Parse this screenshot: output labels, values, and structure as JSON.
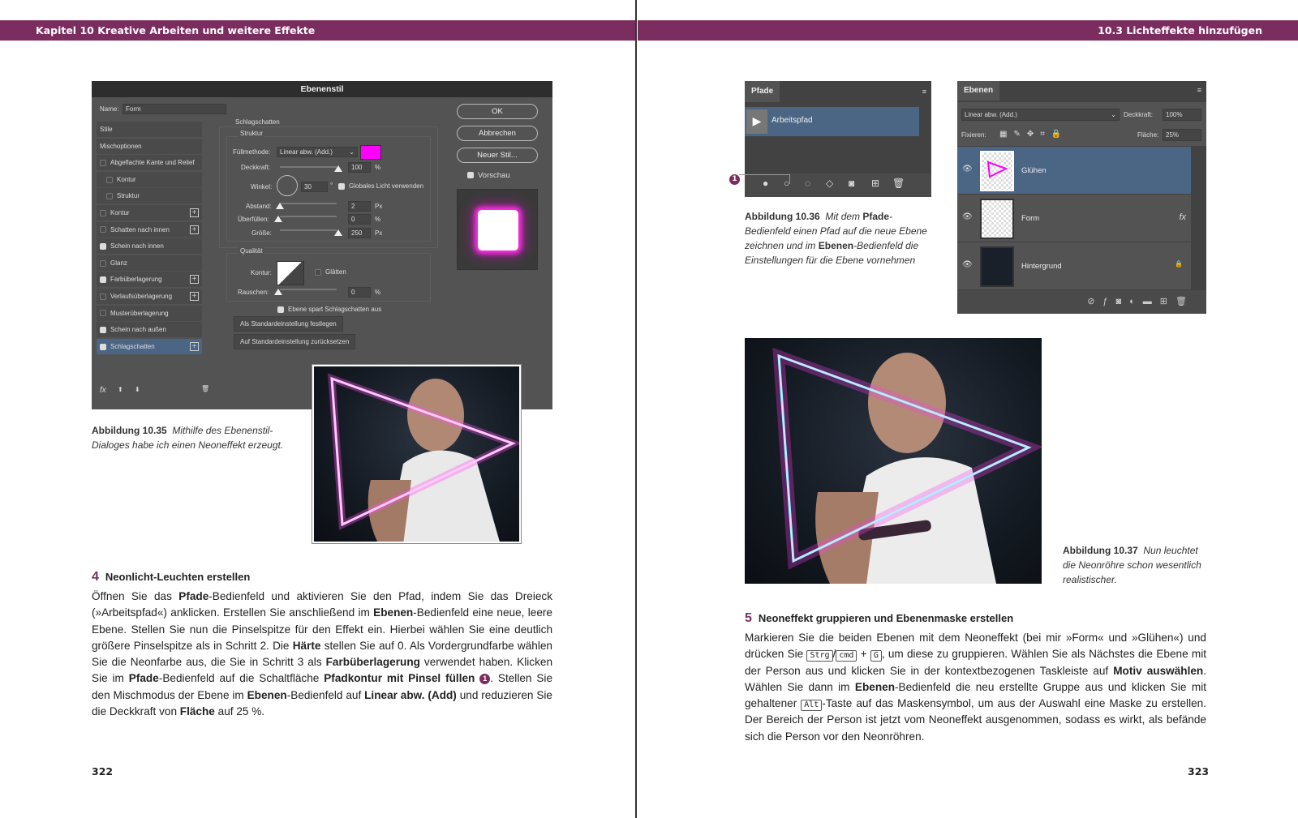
{
  "header": {
    "left": "Kapitel 10  Kreative Arbeiten und weitere Effekte",
    "right": "10.3  Lichteffekte hinzufügen"
  },
  "dialog": {
    "title": "Ebenenstil",
    "name_label": "Name:",
    "name_value": "Form",
    "styles": [
      {
        "label": "Stile",
        "cb": null,
        "plus": false
      },
      {
        "label": "Mischoptionen",
        "cb": null,
        "plus": false
      },
      {
        "label": "Abgeflachte Kante und Relief",
        "cb": false,
        "plus": false
      },
      {
        "label": "Kontur",
        "cb": false,
        "plus": false,
        "indent": true
      },
      {
        "label": "Struktur",
        "cb": false,
        "plus": false,
        "indent": true
      },
      {
        "label": "Kontur",
        "cb": false,
        "plus": true
      },
      {
        "label": "Schatten nach innen",
        "cb": false,
        "plus": true
      },
      {
        "label": "Schein nach innen",
        "cb": true,
        "plus": false
      },
      {
        "label": "Glanz",
        "cb": false,
        "plus": false
      },
      {
        "label": "Farbüberlagerung",
        "cb": true,
        "plus": true
      },
      {
        "label": "Verlaufsüberlagerung",
        "cb": false,
        "plus": true
      },
      {
        "label": "Musterüberlagerung",
        "cb": false,
        "plus": false
      },
      {
        "label": "Schein nach außen",
        "cb": true,
        "plus": false
      },
      {
        "label": "Schlagschatten",
        "cb": true,
        "plus": true,
        "selected": true
      }
    ],
    "section": "Schlagschatten",
    "struktur": "Struktur",
    "fill_label": "Füllmethode:",
    "fill_value": "Linear abw. (Add.)",
    "color": "#ff00ff",
    "opacity_label": "Deckkraft:",
    "opacity_value": "100",
    "opacity_unit": "%",
    "angle_label": "Winkel:",
    "angle_value": "30",
    "angle_unit": "°",
    "global_light": "Globales Licht verwenden",
    "distance_label": "Abstand:",
    "distance_value": "2",
    "distance_unit": "Px",
    "spread_label": "Überfüllen:",
    "spread_value": "0",
    "spread_unit": "%",
    "size_label": "Größe:",
    "size_value": "250",
    "size_unit": "Px",
    "quality": "Qualität",
    "contour_label": "Kontur:",
    "smooth": "Glätten",
    "noise_label": "Rauschen:",
    "noise_value": "0",
    "noise_unit": "%",
    "knockout": "Ebene spart Schlagschatten aus",
    "set_default": "Als Standardeinstellung festlegen",
    "reset_default": "Auf Standardeinstellung zurücksetzen",
    "ok": "OK",
    "cancel": "Abbrechen",
    "new_style": "Neuer Stil...",
    "preview": "Vorschau",
    "fx": "fx"
  },
  "fig35": {
    "label": "Abbildung 10.35",
    "text": "Mithilfe des Ebenenstil-Dialoges habe ich einen Neoneffekt erzeugt."
  },
  "paths": {
    "tab": "Pfade",
    "item": "Arbeitspfad",
    "marker": "1"
  },
  "fig36": {
    "label": "Abbildung 10.36",
    "t1": "Mit dem ",
    "b1": "Pfade",
    "t2": "-Bedienfeld einen Pfad auf die neue Ebene zeichnen und im ",
    "b2": "Ebenen",
    "t3": "-Bedienfeld die Einstellungen für die Ebene vornehmen"
  },
  "layers": {
    "tab": "Ebenen",
    "blend": "Linear abw. (Add.)",
    "opacity_label": "Deckkraft:",
    "opacity": "100%",
    "lock_label": "Fixieren:",
    "fill_label": "Fläche:",
    "fill": "25%",
    "items": [
      {
        "name": "Glühen"
      },
      {
        "name": "Form",
        "fx": "fx"
      },
      {
        "name": "Hintergrund"
      }
    ]
  },
  "fig37": {
    "label": "Abbildung 10.37",
    "text": "Nun leuchtet die Neonröhre schon wesentlich realistischer."
  },
  "step4": {
    "num": "4",
    "title": "Neonlicht-Leuchten erstellen",
    "body": [
      [
        "Öffnen Sie das ",
        0
      ],
      [
        "Pfade",
        1
      ],
      [
        "-Bedienfeld und aktivieren Sie den Pfad, indem Sie das Dreieck (»Arbeitspfad«) anklicken. Erstellen Sie anschließend im ",
        0
      ],
      [
        "Ebenen",
        1
      ],
      [
        "-Bedienfeld eine neue, leere Ebene. Stellen Sie nun die Pinselspitze für den Effekt ein. Hierbei wählen Sie eine deutlich größere Pinselspitze als in Schritt 2. Die ",
        0
      ],
      [
        "Härte",
        1
      ],
      [
        " stellen Sie auf 0. Als Vordergrundfarbe wählen Sie die Neonfarbe aus, die Sie in Schritt 3 als ",
        0
      ],
      [
        "Farbüberlagerung",
        1
      ],
      [
        " verwendet haben. Klicken Sie im ",
        0
      ],
      [
        "Pfade",
        1
      ],
      [
        "-Bedienfeld auf die Schaltfläche ",
        0
      ],
      [
        "Pfadkontur mit Pinsel füllen",
        1
      ],
      [
        " ",
        0
      ],
      [
        "1",
        2
      ],
      [
        ". Stellen Sie den Mischmodus der Ebene im ",
        0
      ],
      [
        "Ebenen",
        1
      ],
      [
        "-Bedienfeld auf ",
        0
      ],
      [
        "Linear abw. (Add)",
        1
      ],
      [
        " und reduzieren Sie die Deckkraft von ",
        0
      ],
      [
        "Fläche",
        1
      ],
      [
        " auf 25 %.",
        0
      ]
    ]
  },
  "step5": {
    "num": "5",
    "title": "Neoneffekt gruppieren und Ebenenmaske erstellen",
    "body": [
      [
        "Markieren Sie die beiden Ebenen mit dem Neoneffekt (bei mir »Form« und »Glühen«) und drücken Sie ",
        0
      ],
      [
        "Strg",
        3
      ],
      [
        "/",
        0
      ],
      [
        "cmd",
        3
      ],
      [
        " + ",
        0
      ],
      [
        "G",
        3
      ],
      [
        ", um diese zu gruppieren. Wählen Sie als Nächstes die Ebene mit der Person aus und klicken Sie in der kontextbezogenen Taskleiste auf ",
        0
      ],
      [
        "Motiv auswählen",
        1
      ],
      [
        ". Wählen Sie dann im ",
        0
      ],
      [
        "Ebenen",
        1
      ],
      [
        "-Bedienfeld die neu erstellte Gruppe aus und klicken Sie mit gehaltener ",
        0
      ],
      [
        "Alt",
        3
      ],
      [
        "-Taste auf das Maskensymbol, um aus der Auswahl eine Maske zu erstellen. Der Bereich der Person ist jetzt vom Neoneffekt ausgenommen, sodass es wirkt, als befände sich die Person vor den Neonröhren.",
        0
      ]
    ]
  },
  "page_left": "322",
  "page_right": "323",
  "colors": {
    "accent": "#7c2d5f",
    "neon": "#ff33ee"
  }
}
